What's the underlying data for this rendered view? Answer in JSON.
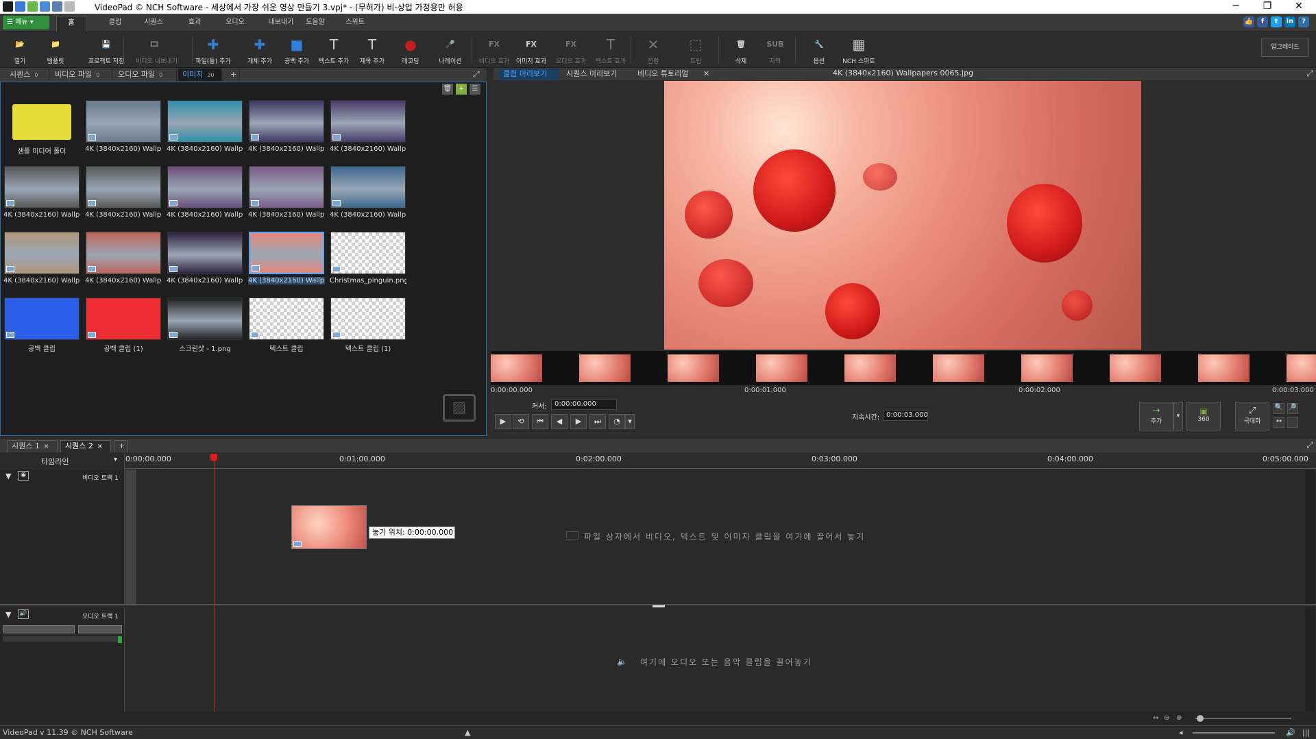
{
  "window": {
    "title": "VideoPad © NCH Software - 세상에서 가장 쉬운 영상 만들기 3.vpj* - (무허가) 비-상업 가정용만 허용",
    "controls": {
      "minimize": "─",
      "restore": "❐",
      "close": "✕"
    }
  },
  "menubar": {
    "menu_button": "메뉴",
    "tabs": [
      "홈",
      "클립",
      "시퀀스",
      "효과",
      "오디오",
      "내보내기",
      "도움말",
      "스위트"
    ],
    "active_tab": "홈",
    "social": [
      "👍",
      "f",
      "t",
      "in",
      "?"
    ]
  },
  "toolbar": {
    "items": [
      {
        "label": "열기",
        "icon": "folder-open-icon",
        "glyph": "📂",
        "disabled": false
      },
      {
        "label": "템플릿",
        "icon": "template-icon",
        "glyph": "📁",
        "disabled": false
      },
      {
        "label": "프로젝트 저장",
        "icon": "save-icon",
        "glyph": "💾",
        "disabled": false
      },
      {
        "label": "비디오 내보내기",
        "icon": "export-video-icon",
        "glyph": "🎞",
        "disabled": true
      },
      {
        "label": "파일(들) 추가",
        "icon": "add-files-icon",
        "glyph": "✚",
        "disabled": false
      },
      {
        "label": "개체 추가",
        "icon": "add-object-icon",
        "glyph": "✚",
        "disabled": false
      },
      {
        "label": "공백 추가",
        "icon": "add-blank-icon",
        "glyph": "■",
        "disabled": false
      },
      {
        "label": "텍스트 추가",
        "icon": "add-text-icon",
        "glyph": "T",
        "disabled": false
      },
      {
        "label": "제목 추가",
        "icon": "add-title-icon",
        "glyph": "T",
        "disabled": false
      },
      {
        "label": "레코딩",
        "icon": "record-icon",
        "glyph": "●",
        "disabled": false
      },
      {
        "label": "나레이션",
        "icon": "microphone-icon",
        "glyph": "🎤",
        "disabled": false
      },
      {
        "label": "비디오 효과",
        "icon": "video-effects-icon",
        "glyph": "FX",
        "disabled": true
      },
      {
        "label": "이미지 효과",
        "icon": "image-effects-icon",
        "glyph": "FX",
        "disabled": false
      },
      {
        "label": "오디오 효과",
        "icon": "audio-effects-icon",
        "glyph": "FX",
        "disabled": true
      },
      {
        "label": "텍스트 효과",
        "icon": "text-effects-icon",
        "glyph": "T",
        "disabled": true
      },
      {
        "label": "전환",
        "icon": "transition-icon",
        "glyph": "✕",
        "disabled": true
      },
      {
        "label": "트림",
        "icon": "trim-icon",
        "glyph": "⬚",
        "disabled": true
      },
      {
        "label": "삭제",
        "icon": "delete-icon",
        "glyph": "🗑",
        "disabled": false
      },
      {
        "label": "자막",
        "icon": "subtitle-icon",
        "glyph": "SUB",
        "disabled": true
      },
      {
        "label": "옵션",
        "icon": "options-icon",
        "glyph": "🔧",
        "disabled": false
      },
      {
        "label": "NCH 스위트",
        "icon": "nch-suite-icon",
        "glyph": "▦",
        "disabled": false
      }
    ],
    "upgrade": "업그레이드"
  },
  "bin": {
    "tabs": [
      {
        "label": "시퀀스",
        "count": "0"
      },
      {
        "label": "비디오 파일",
        "count": "0"
      },
      {
        "label": "오디오 파일",
        "count": "0"
      },
      {
        "label": "이미지",
        "count": "20"
      }
    ],
    "active_tab": "이미지",
    "add_tab": "+",
    "items": [
      {
        "caption": "샘플 미디어 폴더",
        "kind": "folder",
        "color": "#e6dc3a"
      },
      {
        "caption": "4K (3840x2160) Wallp...",
        "kind": "image",
        "color": "#6a7a8c"
      },
      {
        "caption": "4K (3840x2160) Wallp...",
        "kind": "image",
        "color": "#2e8fa8"
      },
      {
        "caption": "4K (3840x2160) Wallp...",
        "kind": "image",
        "color": "#3d3763"
      },
      {
        "caption": "4K (3840x2160) Wallp...",
        "kind": "image",
        "color": "#4a3a6a"
      },
      {
        "caption": "4K (3840x2160) Wallp...",
        "kind": "image",
        "color": "#555555"
      },
      {
        "caption": "4K (3840x2160) Wallp...",
        "kind": "image",
        "color": "#5a5a5a"
      },
      {
        "caption": "4K (3840x2160) Wallp...",
        "kind": "image",
        "color": "#6b4e7a"
      },
      {
        "caption": "4K (3840x2160) Wallp...",
        "kind": "image",
        "color": "#7a5a88"
      },
      {
        "caption": "4K (3840x2160) Wallp...",
        "kind": "image",
        "color": "#3c6a90"
      },
      {
        "caption": "4K (3840x2160) Wallp...",
        "kind": "image",
        "color": "#b0987a"
      },
      {
        "caption": "4K (3840x2160) Wallp...",
        "kind": "image",
        "color": "#c06458"
      },
      {
        "caption": "4K (3840x2160) Wallp...",
        "kind": "image",
        "color": "#2d2240"
      },
      {
        "caption": "4K (3840x2160) Wallp...",
        "kind": "image",
        "color": "#e6877a",
        "selected": true
      },
      {
        "caption": "Christmas_pinguin.png",
        "kind": "transparent",
        "color": "#cccccc"
      },
      {
        "caption": "공백 클립",
        "kind": "solid",
        "color": "#2c5de8"
      },
      {
        "caption": "공백 클립 (1)",
        "kind": "solid",
        "color": "#ee2e32"
      },
      {
        "caption": "스크린샷 - 1.png",
        "kind": "image",
        "color": "#222222"
      },
      {
        "caption": "텍스트 클립",
        "kind": "transparent",
        "color": "#cccccc"
      },
      {
        "caption": "텍스트 클립 (1)",
        "kind": "transparent",
        "color": "#cccccc"
      }
    ]
  },
  "preview": {
    "tabs": [
      "클립 미리보기",
      "시퀀스 미리보기",
      "비디오 튜토리얼"
    ],
    "active_tab": "클립 미리보기",
    "clip_name": "4K (3840x2160) Wallpapers 0065.jpg",
    "ruler": [
      "0:00:00.000",
      "0:00:01.000",
      "0:00:02.000",
      "0:00:03.000"
    ],
    "cursor_label": "커서:",
    "cursor_value": "0:00:00.000",
    "duration_label": "지속시간:",
    "duration_value": "0:00:03.000",
    "add_button": "추가",
    "vr_button": "360",
    "fullscreen_button": "극대화"
  },
  "timeline": {
    "sequence_tabs": [
      "시퀀스 1",
      "시퀀스 2"
    ],
    "active_sequence": "시퀀스 2",
    "mode_label": "타임라인",
    "ruler": [
      "0:00:00.000",
      "0:01:00.000",
      "0:02:00.000",
      "0:03:00.000",
      "0:04:00.000",
      "0:05:00.000"
    ],
    "video_track": "비디오 트랙 1",
    "audio_track": "오디오 트랙 1",
    "video_hint": "파일 상자에서 비디오, 텍스트 및 이미지 클립을 여기에 끌어서 놓기",
    "audio_hint": "여기에 오디오 또는 음악 클립을 끌어놓기",
    "drop_tooltip": "놓기 위치: 0:00:00.000"
  },
  "status": {
    "version": "VideoPad v 11.39 © NCH Software"
  }
}
